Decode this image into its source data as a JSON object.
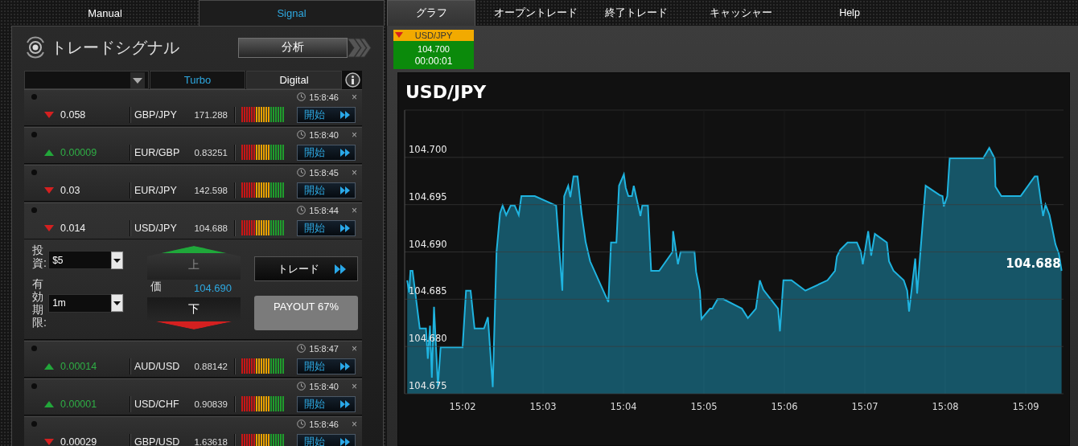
{
  "left_tabs": [
    {
      "label": "Manual",
      "selected": false
    },
    {
      "label": "Signal",
      "selected": true
    }
  ],
  "signal_panel": {
    "title": "トレードシグナル",
    "analysis_button": "分析",
    "filter_tabs": [
      {
        "label": "Turbo",
        "selected": true
      },
      {
        "label": "Digital",
        "selected": false
      }
    ],
    "signals": [
      {
        "up": false,
        "change": "0.058",
        "pair": "GBP/JPY",
        "price": "171.288",
        "time": "15:8:46",
        "close": "×",
        "button": "開始"
      },
      {
        "up": true,
        "change": "0.00009",
        "pair": "EUR/GBP",
        "price": "0.83251",
        "time": "15:8:40",
        "close": "×",
        "button": "開始"
      },
      {
        "up": false,
        "change": "0.03",
        "pair": "EUR/JPY",
        "price": "142.598",
        "time": "15:8:45",
        "close": "×",
        "button": "開始"
      },
      {
        "up": false,
        "change": "0.014",
        "pair": "USD/JPY",
        "price": "104.688",
        "time": "15:8:44",
        "close": "×",
        "button": "開始",
        "trade_form": {
          "investment_label": "投資:",
          "investment": "$5",
          "expiry_label": "有効期限:",
          "expiry": "1m",
          "up_button": {
            "label": "上",
            "disabled": true
          },
          "price_label": "価",
          "price": "104.690",
          "down_button": {
            "label": "下",
            "disabled": false
          },
          "trade_button": "トレード",
          "payout": "PAYOUT 67%"
        }
      },
      {
        "up": true,
        "change": "0.00014",
        "pair": "AUD/USD",
        "price": "0.88142",
        "time": "15:8:47",
        "close": "×",
        "button": "開始"
      },
      {
        "up": true,
        "change": "0.00001",
        "pair": "USD/CHF",
        "price": "0.90839",
        "time": "15:8:40",
        "close": "×",
        "button": "開始"
      },
      {
        "up": false,
        "change": "0.00029",
        "pair": "GBP/USD",
        "price": "1.63618",
        "time": "15:8:46",
        "close": "×",
        "button": "開始"
      }
    ]
  },
  "nav_tabs": [
    {
      "label": "グラフ",
      "selected": true
    },
    {
      "label": "オープントレード",
      "selected": false
    },
    {
      "label": "終了トレード",
      "selected": false
    },
    {
      "label": "キャッシャー",
      "selected": false
    },
    {
      "label": "Help",
      "selected": false
    }
  ],
  "ticker": {
    "up": false,
    "pair": "USD/JPY",
    "price": "104.700",
    "countdown": "00:00:01"
  },
  "chart": {
    "chart_data": {
      "type": "area",
      "grid": true,
      "x": [
        901.312,
        901.336,
        901.352,
        901.378,
        901.468,
        901.545,
        901.568,
        901.595,
        901.618,
        901.645,
        901.694,
        901.727,
        902.0,
        902.043,
        902.1,
        902.149,
        902.266,
        902.315,
        902.375,
        902.422,
        902.466,
        902.498,
        902.542,
        902.598,
        902.648,
        902.698,
        902.731,
        902.898,
        903.163,
        903.24,
        903.263,
        903.313,
        903.34,
        903.379,
        903.429,
        903.479,
        903.529,
        903.586,
        903.812,
        903.845,
        903.912,
        903.945,
        904.005,
        904.028,
        904.061,
        904.105,
        904.128,
        904.211,
        904.234,
        904.304,
        904.344,
        904.444,
        904.61,
        904.617,
        904.677,
        904.71,
        904.883,
        904.903,
        904.95,
        904.97,
        905.076,
        905.103,
        905.17,
        905.243,
        905.473,
        905.546,
        905.646,
        905.695,
        905.739,
        905.922,
        905.945,
        905.988,
        906.088,
        906.261,
        906.536,
        906.629,
        906.653,
        906.693,
        906.786,
        906.902,
        906.952,
        906.975,
        907.042,
        907.079,
        907.125,
        907.274,
        907.301,
        907.357,
        907.484,
        907.527,
        907.55,
        907.627,
        907.65,
        907.756,
        907.932,
        907.966,
        907.982,
        908.025,
        908.055,
        908.471,
        908.547,
        908.614,
        908.624,
        908.697,
        908.937,
        909.113,
        909.146,
        909.216,
        909.246,
        909.296,
        909.37,
        909.413,
        909.446
      ],
      "series": [
        {
          "name": "USD/JPY",
          "color": "#1fb4e0",
          "values": [
            104.687,
            104.6857,
            104.688,
            104.688,
            104.6819,
            104.6819,
            104.6787,
            104.6822,
            104.6767,
            104.6842,
            104.6758,
            104.6799,
            104.6799,
            104.6859,
            104.6859,
            104.6819,
            104.6819,
            104.6831,
            104.6757,
            104.69,
            104.6941,
            104.6949,
            104.6939,
            104.6949,
            104.6949,
            104.6939,
            104.6959,
            104.6959,
            104.6949,
            104.6859,
            104.6959,
            104.697,
            104.6958,
            104.698,
            104.698,
            104.6941,
            104.6911,
            104.689,
            104.6847,
            104.691,
            104.691,
            104.697,
            104.6982,
            104.6968,
            104.6959,
            104.6959,
            104.697,
            104.6938,
            104.6949,
            104.6949,
            104.688,
            104.688,
            104.69,
            104.6922,
            104.6887,
            104.69,
            104.69,
            104.6879,
            104.6859,
            104.6829,
            104.684,
            104.684,
            104.685,
            104.685,
            104.684,
            104.683,
            104.684,
            104.687,
            104.686,
            104.684,
            104.6816,
            104.687,
            104.687,
            104.6859,
            104.687,
            104.688,
            104.6895,
            104.6902,
            104.691,
            104.691,
            104.69,
            104.6887,
            104.6922,
            104.6896,
            104.6919,
            104.691,
            104.689,
            104.688,
            104.687,
            104.6859,
            104.6837,
            104.6893,
            104.6856,
            104.697,
            104.696,
            104.6959,
            104.6948,
            104.6959,
            104.6999,
            104.6999,
            104.701,
            104.6999,
            104.6969,
            104.6959,
            104.6959,
            104.698,
            104.698,
            104.6938,
            104.695,
            104.6939,
            104.6908,
            104.6898,
            104.688
          ]
        }
      ],
      "xlim": [
        901.28,
        909.47
      ],
      "ylim": [
        104.675,
        104.705
      ],
      "xticks": [
        {
          "value": 902,
          "label": "15:02"
        },
        {
          "value": 903,
          "label": "15:03"
        },
        {
          "value": 904,
          "label": "15:04"
        },
        {
          "value": 905,
          "label": "15:05"
        },
        {
          "value": 906,
          "label": "15:06"
        },
        {
          "value": 907,
          "label": "15:07"
        },
        {
          "value": 908,
          "label": "15:08"
        },
        {
          "value": 909,
          "label": "15:09"
        }
      ],
      "yticks": [
        {
          "value": 104.675,
          "label": "104.675"
        },
        {
          "value": 104.68,
          "label": "104.680"
        },
        {
          "value": 104.685,
          "label": "104.685"
        },
        {
          "value": 104.69,
          "label": "104.690"
        },
        {
          "value": 104.695,
          "label": "104.695"
        },
        {
          "value": 104.7,
          "label": "104.700"
        }
      ],
      "annotations": [
        {
          "x": 909.446,
          "y": 104.688,
          "text": "104.688"
        }
      ]
    }
  }
}
